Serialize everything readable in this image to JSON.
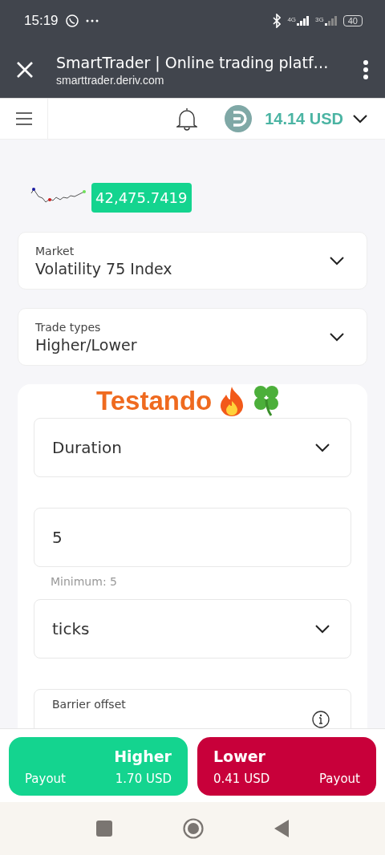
{
  "status_bar": {
    "time": "15:19",
    "network_labels": [
      "4G",
      "3G"
    ],
    "battery": "40"
  },
  "browser": {
    "title": "SmartTrader | Online trading platf…",
    "url": "smarttrader.deriv.com"
  },
  "app_header": {
    "balance": "14.14 USD"
  },
  "ticker": {
    "price": "42,475.7419"
  },
  "selectors": [
    {
      "label": "Market",
      "value": "Volatility 75 Index"
    },
    {
      "label": "Trade types",
      "value": "Higher/Lower"
    }
  ],
  "form": [
    {
      "kind": "select",
      "value": "Duration"
    },
    {
      "kind": "input",
      "value": "5",
      "hint": "Minimum: 5"
    },
    {
      "kind": "select",
      "value": "ticks"
    },
    {
      "kind": "info",
      "label": "Barrier offset"
    }
  ],
  "overlay_caption": "Testando",
  "actions": [
    {
      "kind": "higher",
      "title": "Higher",
      "payout_label": "Payout",
      "amount": "1.70 USD"
    },
    {
      "kind": "lower",
      "title": "Lower",
      "payout_label": "Payout",
      "amount": "0.41 USD"
    }
  ]
}
